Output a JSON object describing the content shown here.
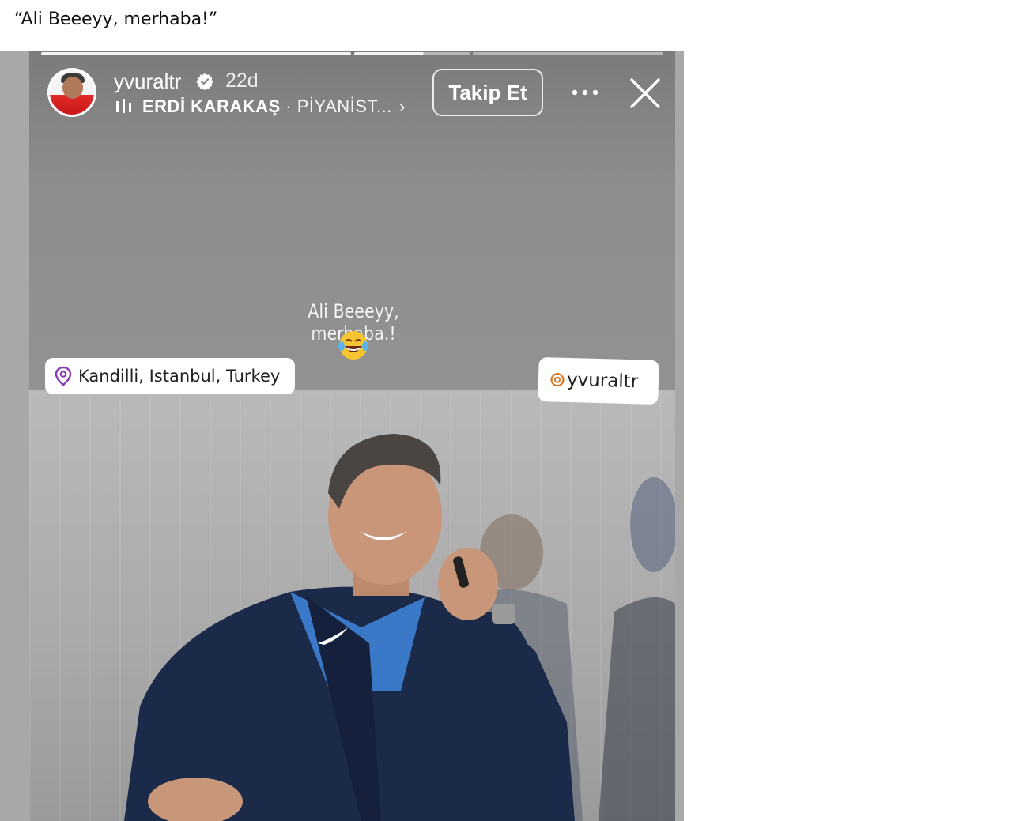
{
  "caption": "“Ali Beeeyy, merhaba!”",
  "story": {
    "progress_bars": [
      {
        "state": "viewed"
      },
      {
        "state": "current",
        "fraction": 0.6
      },
      {
        "state": "upcoming"
      }
    ],
    "header": {
      "username": "yvuraltr",
      "time": "22d",
      "verified": true,
      "music_artist": "ERDİ KARAKAŞ",
      "music_separator": " · ",
      "music_song": "PİYANİST...",
      "follow_label": "Takip Et",
      "more_icon": "more-horizontal-icon",
      "close_icon": "close-icon"
    },
    "text_overlay": "Ali Beeeyy, merhaba.!",
    "emoji": "face-with-tears-of-joy",
    "location_sticker": "Kandilli, Istanbul, Turkey",
    "mention_sticker": "yvuraltr"
  },
  "colors": {
    "location_pin": "#8a3ab9",
    "avatar_shirt": "#d42020",
    "emoji_yellow": "#f7c531"
  }
}
